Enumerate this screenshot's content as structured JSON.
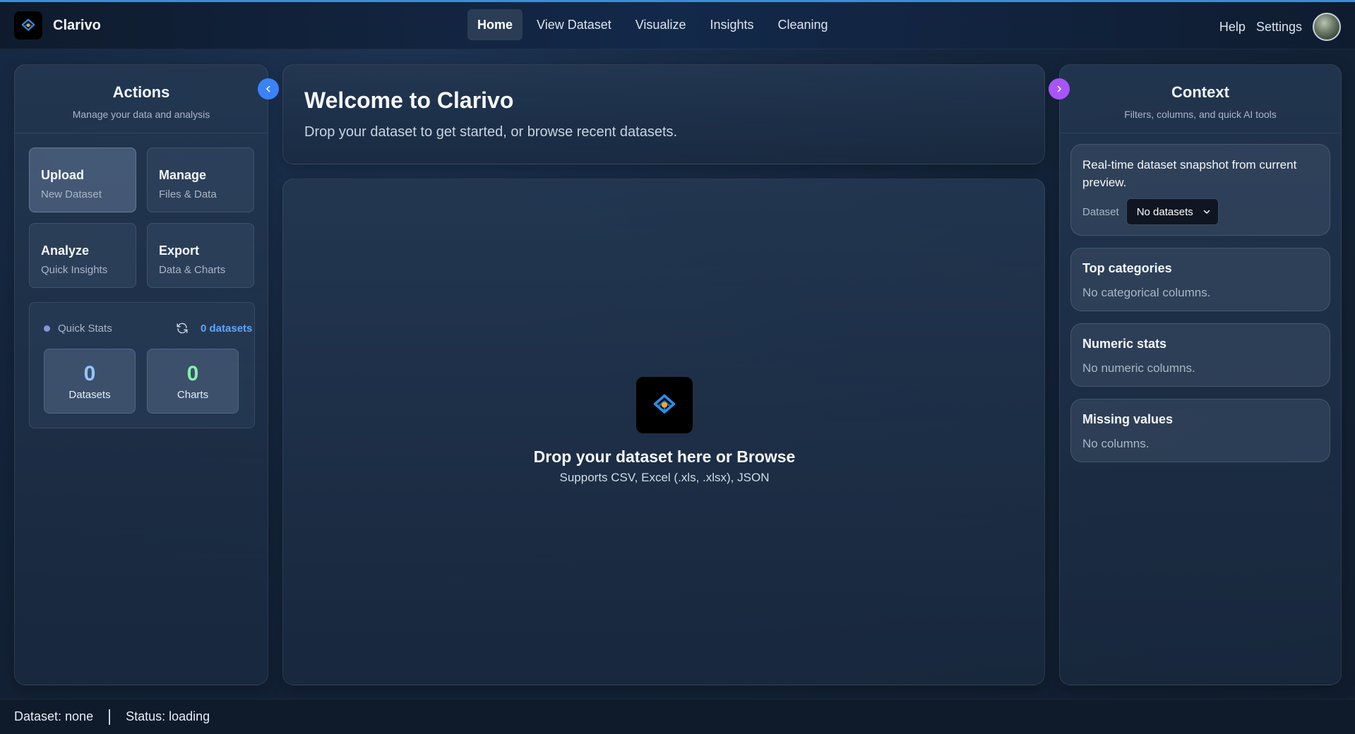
{
  "app": {
    "name": "Clarivo"
  },
  "nav": {
    "items": [
      {
        "label": "Home",
        "active": true
      },
      {
        "label": "View Dataset",
        "active": false
      },
      {
        "label": "Visualize",
        "active": false
      },
      {
        "label": "Insights",
        "active": false
      },
      {
        "label": "Cleaning",
        "active": false
      }
    ],
    "help": "Help",
    "settings": "Settings"
  },
  "actions": {
    "title": "Actions",
    "subtitle": "Manage your data and analysis",
    "cards": [
      {
        "title": "Upload",
        "sub": "New Dataset"
      },
      {
        "title": "Manage",
        "sub": "Files & Data"
      },
      {
        "title": "Analyze",
        "sub": "Quick Insights"
      },
      {
        "title": "Export",
        "sub": "Data & Charts"
      }
    ],
    "quick_stats": {
      "label": "Quick Stats",
      "dataset_count_label": "0 datasets",
      "datasets_value": "0",
      "datasets_label": "Datasets",
      "charts_value": "0",
      "charts_label": "Charts"
    }
  },
  "welcome": {
    "title": "Welcome to Clarivo",
    "subtitle": "Drop your dataset to get started, or browse recent datasets."
  },
  "dropzone": {
    "title": "Drop your dataset here or Browse",
    "subtitle": "Supports CSV, Excel (.xls, .xlsx), JSON"
  },
  "context": {
    "title": "Context",
    "subtitle": "Filters, columns, and quick AI tools",
    "snapshot_text": "Real-time dataset snapshot from current preview.",
    "dataset_label": "Dataset",
    "dataset_select": "No datasets",
    "cards": [
      {
        "title": "Top categories",
        "desc": "No categorical columns."
      },
      {
        "title": "Numeric stats",
        "desc": "No numeric columns."
      },
      {
        "title": "Missing values",
        "desc": "No columns."
      }
    ]
  },
  "status": {
    "dataset": "Dataset: none",
    "state": "Status: loading"
  },
  "colors": {
    "accent_blue": "#3b82f6",
    "accent_purple": "#a855f7",
    "datasets_number": "#93c5fd",
    "charts_number": "#86efac",
    "logo_orange": "#f59e0b",
    "logo_blue": "#1e90ff"
  },
  "icons": [
    "clarivo-logo-icon",
    "chevron-left-icon",
    "chevron-right-icon",
    "refresh-icon",
    "chevron-down-icon",
    "avatar"
  ]
}
